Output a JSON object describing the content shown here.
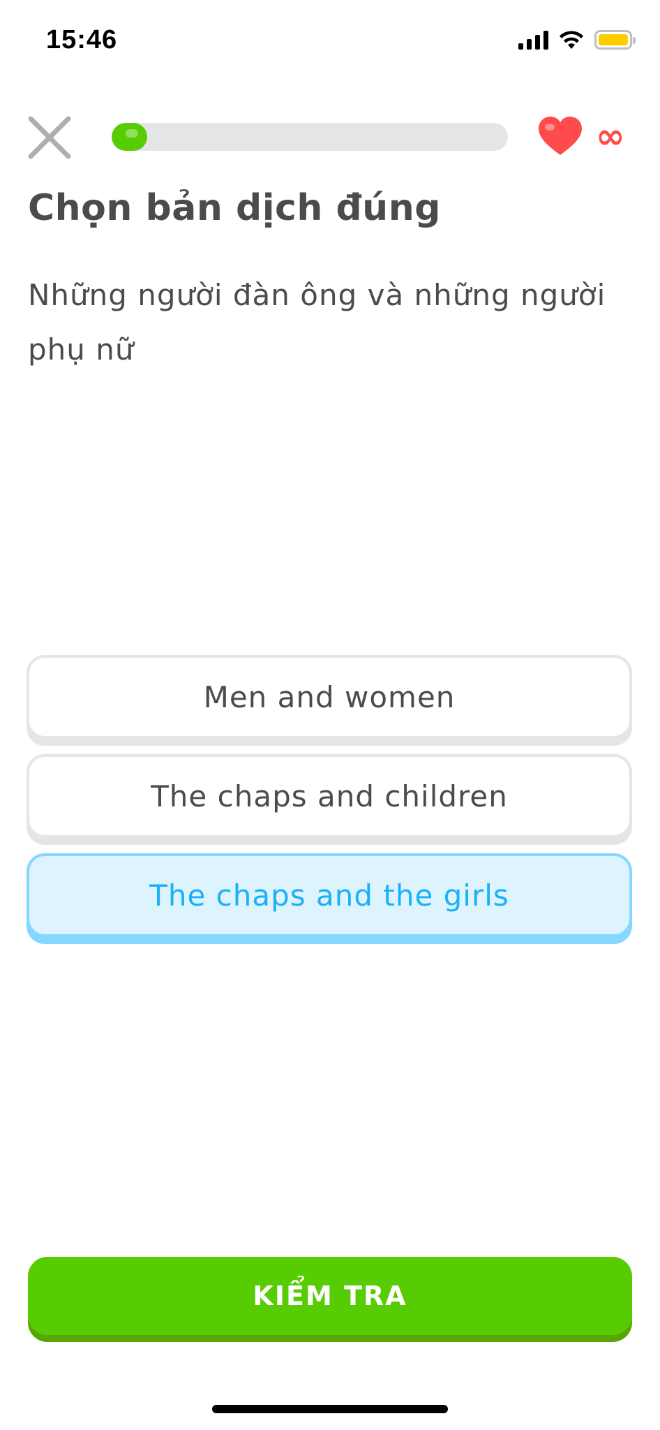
{
  "status_bar": {
    "time": "15:46",
    "signal_icon": "cellular-signal-icon",
    "wifi_icon": "wifi-icon",
    "battery_icon": "battery-icon",
    "battery_color": "#ffcc00"
  },
  "lesson_header": {
    "close_icon": "close-icon",
    "progress_fraction": 0.09,
    "progress_color": "#58cc02",
    "heart_icon": "heart-icon",
    "hearts_label": "∞",
    "hearts_color": "#ff4b4b"
  },
  "prompt": {
    "title": "Chọn bản dịch đúng",
    "sentence": "Những người đàn ông và những người phụ nữ"
  },
  "options": [
    {
      "label": "Men and women",
      "selected": false
    },
    {
      "label": "The chaps and children",
      "selected": false
    },
    {
      "label": "The chaps and the girls",
      "selected": true
    }
  ],
  "check_button": {
    "label": "KIỂM TRA",
    "color": "#58cc02"
  }
}
